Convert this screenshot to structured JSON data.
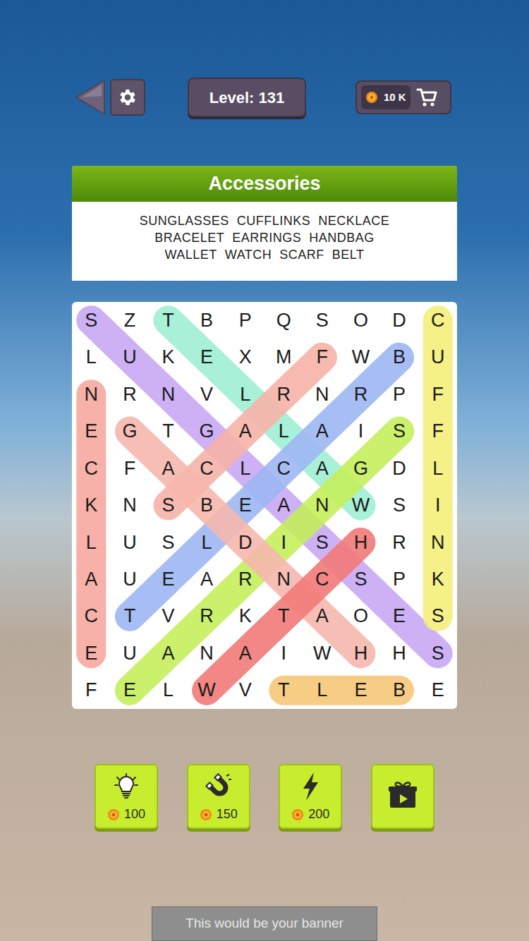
{
  "top_bar": {
    "level": "Level: 131",
    "coins": "10 K"
  },
  "category": {
    "title": "Accessories",
    "words": [
      [
        "SUNGLASSES",
        "CUFFLINKS",
        "NECKLACE"
      ],
      [
        "BRACELET",
        "EARRINGS",
        "HANDBAG"
      ],
      [
        "WALLET",
        "WATCH",
        "SCARF",
        "BELT"
      ]
    ]
  },
  "grid": {
    "rows": [
      [
        "S",
        "Z",
        "T",
        "B",
        "P",
        "Q",
        "S",
        "O",
        "D",
        "C"
      ],
      [
        "L",
        "U",
        "K",
        "E",
        "X",
        "M",
        "F",
        "W",
        "B",
        "U"
      ],
      [
        "N",
        "R",
        "N",
        "V",
        "L",
        "R",
        "N",
        "R",
        "P",
        "F"
      ],
      [
        "E",
        "G",
        "T",
        "G",
        "A",
        "L",
        "A",
        "I",
        "S",
        "F"
      ],
      [
        "C",
        "F",
        "A",
        "C",
        "L",
        "C",
        "A",
        "G",
        "D",
        "L"
      ],
      [
        "K",
        "N",
        "S",
        "B",
        "E",
        "A",
        "N",
        "W",
        "S",
        "I"
      ],
      [
        "L",
        "U",
        "S",
        "L",
        "D",
        "I",
        "S",
        "H",
        "R",
        "N"
      ],
      [
        "A",
        "U",
        "E",
        "A",
        "R",
        "N",
        "C",
        "S",
        "P",
        "K"
      ],
      [
        "C",
        "T",
        "V",
        "R",
        "K",
        "T",
        "A",
        "O",
        "E",
        "S"
      ],
      [
        "E",
        "U",
        "A",
        "N",
        "A",
        "I",
        "W",
        "H",
        "H",
        "S"
      ],
      [
        "F",
        "E",
        "L",
        "W",
        "V",
        "T",
        "L",
        "E",
        "B",
        "E"
      ]
    ]
  },
  "highlights": [
    {
      "start": [
        0,
        0
      ],
      "end": [
        9,
        9
      ],
      "color": "#c9a8f4"
    },
    {
      "start": [
        0,
        2
      ],
      "end": [
        5,
        7
      ],
      "color": "#9ff0d4"
    },
    {
      "start": [
        8,
        1
      ],
      "end": [
        1,
        8
      ],
      "color": "#9db7f4"
    },
    {
      "start": [
        10,
        1
      ],
      "end": [
        3,
        8
      ],
      "color": "#c4ee5c"
    },
    {
      "start": [
        5,
        2
      ],
      "end": [
        1,
        6
      ],
      "color": "#f6b3a8"
    },
    {
      "start": [
        3,
        1
      ],
      "end": [
        9,
        7
      ],
      "color": "#f6b7ae"
    },
    {
      "start": [
        10,
        3
      ],
      "end": [
        6,
        7
      ],
      "color": "#f27a78"
    },
    {
      "start": [
        2,
        0
      ],
      "end": [
        9,
        0
      ],
      "color": "#f6a99f"
    },
    {
      "start": [
        0,
        9
      ],
      "end": [
        8,
        9
      ],
      "color": "#f4f07a"
    },
    {
      "start": [
        10,
        5
      ],
      "end": [
        10,
        8
      ],
      "color": "#f6c878"
    }
  ],
  "tools": [
    {
      "kind": "hint",
      "cost": "100"
    },
    {
      "kind": "magnet",
      "cost": "150"
    },
    {
      "kind": "lightning",
      "cost": "200"
    },
    {
      "kind": "video"
    }
  ],
  "banner": "This would be your banner"
}
